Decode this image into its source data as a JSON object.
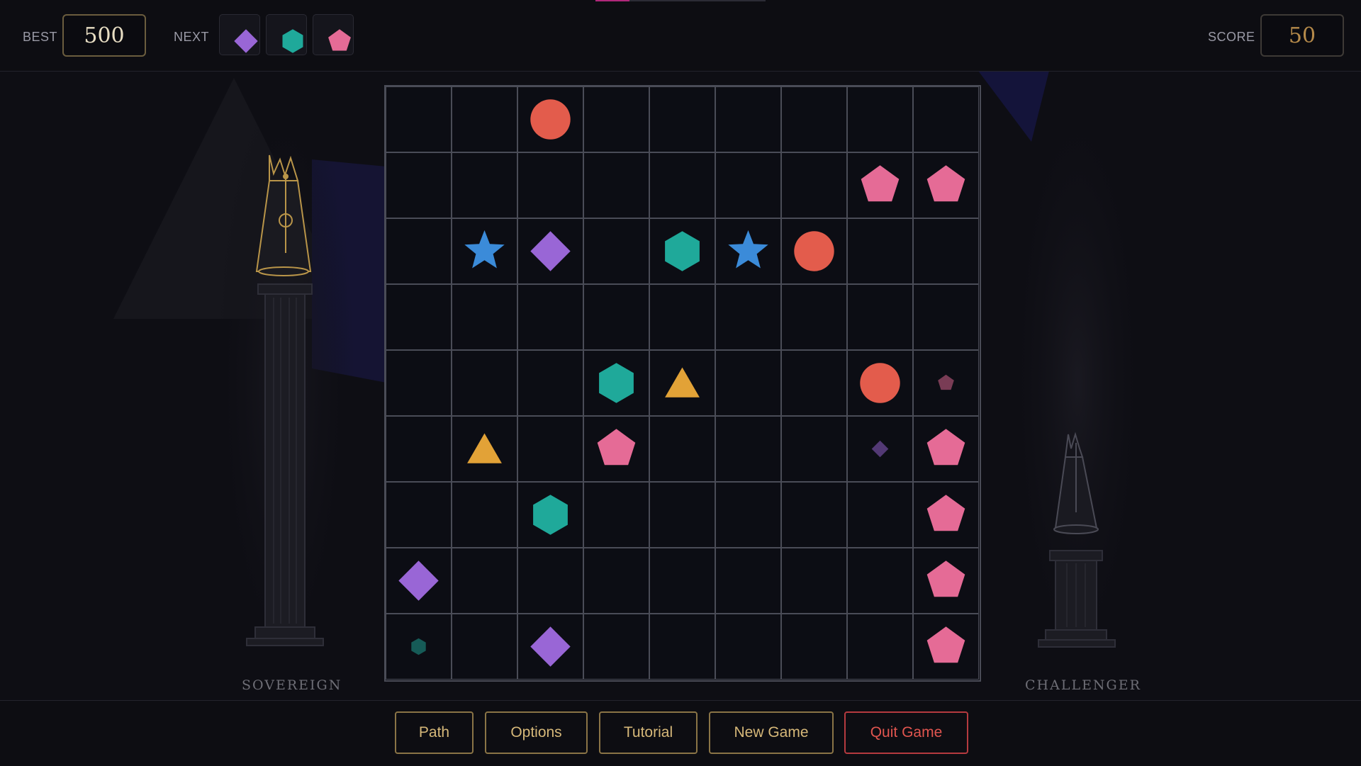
{
  "header": {
    "best_label": "BEST",
    "best_value": "500",
    "next_label": "NEXT",
    "next_pieces": [
      "diamond",
      "hexagon",
      "pentagon"
    ],
    "score_label": "SCORE",
    "score_value": "50"
  },
  "pieces": {
    "circle": "#e35c4c",
    "pentagon": "#e56b96",
    "diamond": "#9966d6",
    "hexagon": "#1fa99a",
    "star": "#3b8bd9",
    "triangle": "#e2a237"
  },
  "board": {
    "rows": 9,
    "cols": 9,
    "pieces": [
      {
        "row": 0,
        "col": 2,
        "shape": "circle",
        "size": "full"
      },
      {
        "row": 1,
        "col": 7,
        "shape": "pentagon",
        "size": "full"
      },
      {
        "row": 1,
        "col": 8,
        "shape": "pentagon",
        "size": "full"
      },
      {
        "row": 2,
        "col": 1,
        "shape": "star",
        "size": "full"
      },
      {
        "row": 2,
        "col": 2,
        "shape": "diamond",
        "size": "full"
      },
      {
        "row": 2,
        "col": 4,
        "shape": "hexagon",
        "size": "full"
      },
      {
        "row": 2,
        "col": 5,
        "shape": "star",
        "size": "full"
      },
      {
        "row": 2,
        "col": 6,
        "shape": "circle",
        "size": "full"
      },
      {
        "row": 4,
        "col": 3,
        "shape": "hexagon",
        "size": "full"
      },
      {
        "row": 4,
        "col": 4,
        "shape": "triangle",
        "size": "full"
      },
      {
        "row": 4,
        "col": 7,
        "shape": "circle",
        "size": "full"
      },
      {
        "row": 4,
        "col": 8,
        "shape": "pentagon",
        "size": "small"
      },
      {
        "row": 5,
        "col": 1,
        "shape": "triangle",
        "size": "full"
      },
      {
        "row": 5,
        "col": 3,
        "shape": "pentagon",
        "size": "full"
      },
      {
        "row": 5,
        "col": 7,
        "shape": "diamond",
        "size": "small"
      },
      {
        "row": 5,
        "col": 8,
        "shape": "pentagon",
        "size": "full"
      },
      {
        "row": 6,
        "col": 2,
        "shape": "hexagon",
        "size": "full"
      },
      {
        "row": 6,
        "col": 8,
        "shape": "pentagon",
        "size": "full"
      },
      {
        "row": 7,
        "col": 0,
        "shape": "diamond",
        "size": "full"
      },
      {
        "row": 7,
        "col": 8,
        "shape": "pentagon",
        "size": "full"
      },
      {
        "row": 8,
        "col": 0,
        "shape": "hexagon",
        "size": "small"
      },
      {
        "row": 8,
        "col": 2,
        "shape": "diamond",
        "size": "full"
      },
      {
        "row": 8,
        "col": 8,
        "shape": "pentagon",
        "size": "full"
      }
    ]
  },
  "players": {
    "left": "SOVEREIGN",
    "right": "CHALLENGER"
  },
  "buttons": {
    "path": "Path",
    "options": "Options",
    "tutorial": "Tutorial",
    "new_game": "New Game",
    "quit_game": "Quit Game"
  }
}
